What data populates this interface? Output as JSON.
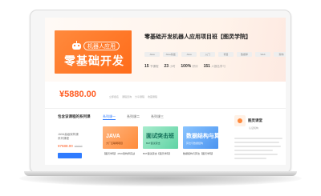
{
  "course": {
    "cover_badge": "机器人应用",
    "cover_title": "零基础开发",
    "title": "零基础开发机器人应用项目班【图灵学院】",
    "tags": [
      "Java",
      "Java基础",
      "Java",
      "入门",
      "项目",
      "数据库",
      "Web",
      "架构"
    ],
    "stats": [
      {
        "num": "15",
        "unit": "节课程"
      },
      {
        "num": "23",
        "unit": "小时"
      },
      {
        "num": "100%",
        "unit": "好评"
      },
      {
        "num": "151",
        "unit": "人报名学习"
      }
    ]
  },
  "price_bar": {
    "price": "¥5880.00",
    "links": [
      "立即报名",
      "课程咨询",
      "分享课程",
      "收藏课程"
    ]
  },
  "series": {
    "title": "包含该课程的系列课",
    "tabs": [
      "系列课一",
      "系列课二",
      "系列课三"
    ],
    "side_info": {
      "line1": "JAVA高级架构课",
      "line2": "系列课程",
      "price": "¥7688.00",
      "strike": "¥9999"
    },
    "cards": [
      {
        "big": "JAVA",
        "small": "大厂互联网项目",
        "caption": "【图灵学院】JAVA架构师实战"
      },
      {
        "big": "面试突击班",
        "small": "BAT面试突击",
        "caption": "BAT面试突击【图灵学院】"
      },
      {
        "big": "数据结构与算法",
        "small": "算法与数据结构",
        "caption": "数据结构与算法【图灵学院】"
      }
    ]
  },
  "sidebar": {
    "name": "图灵课堂",
    "sub": "认证机构",
    "lines": [
      "",
      "",
      "",
      "",
      "",
      ""
    ]
  }
}
